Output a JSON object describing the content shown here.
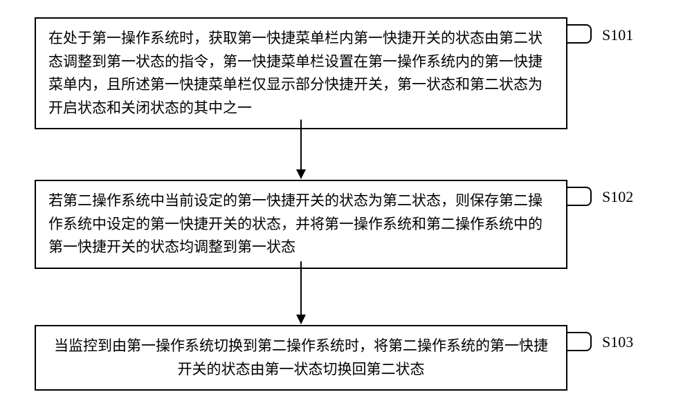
{
  "flowchart": {
    "steps": [
      {
        "label": "S101",
        "text": "在处于第一操作系统时，获取第一快捷菜单栏内第一快捷开关的状态由第二状态调整到第一状态的指令，第一快捷菜单栏设置在第一操作系统内的第一快捷菜单内，且所述第一快捷菜单栏仅显示部分快捷开关，第一状态和第二状态为开启状态和关闭状态的其中之一"
      },
      {
        "label": "S102",
        "text": "若第二操作系统中当前设定的第一快捷开关的状态为第二状态，则保存第二操作系统中设定的第一快捷开关的状态，并将第一操作系统和第二操作系统中的第一快捷开关的状态均调整到第一状态"
      },
      {
        "label": "S103",
        "text": "当监控到由第一操作系统切换到第二操作系统时，将第二操作系统的第一快捷开关的状态由第一状态切换回第二状态"
      }
    ]
  }
}
